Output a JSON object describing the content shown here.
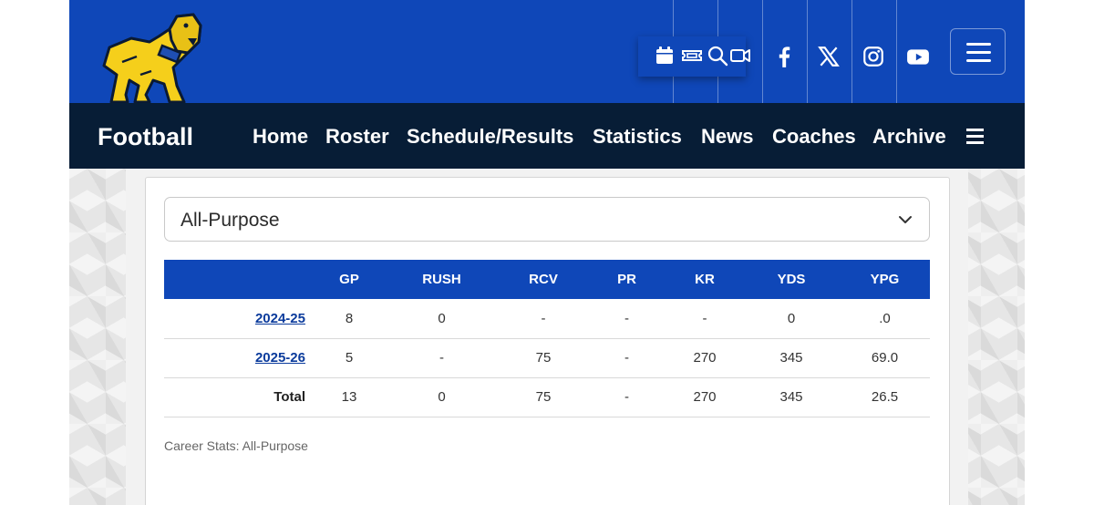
{
  "colors": {
    "primary": "#0f47b8",
    "navbar": "#071d36",
    "link": "#0b3b9c"
  },
  "header": {
    "logo": "bulldog-mascot-logo",
    "utility_icons": [
      "calendar-icon",
      "ticket-icon",
      "search-icon",
      "video-icon"
    ],
    "social_icons": [
      "facebook-icon",
      "x-icon",
      "instagram-icon",
      "youtube-icon"
    ],
    "menu_icon": "hamburger-menu-icon"
  },
  "nav": {
    "title": "Football",
    "items": [
      "Home",
      "Roster",
      "Schedule/Results",
      "Statistics",
      "News",
      "Coaches",
      "Archive"
    ],
    "more_icon": "hamburger-icon"
  },
  "stats": {
    "select": {
      "value": "All-Purpose"
    },
    "columns": [
      "",
      "GP",
      "RUSH",
      "RCV",
      "PR",
      "KR",
      "YDS",
      "YPG"
    ],
    "rows": [
      {
        "season": "2024-25",
        "cells": [
          "8",
          "0",
          "-",
          "-",
          "-",
          "0",
          ".0"
        ]
      },
      {
        "season": "2025-26",
        "cells": [
          "5",
          "-",
          "75",
          "-",
          "270",
          "345",
          "69.0"
        ]
      }
    ],
    "total": {
      "label": "Total",
      "cells": [
        "13",
        "0",
        "75",
        "-",
        "270",
        "345",
        "26.5"
      ]
    },
    "caption": "Career Stats: All-Purpose"
  }
}
